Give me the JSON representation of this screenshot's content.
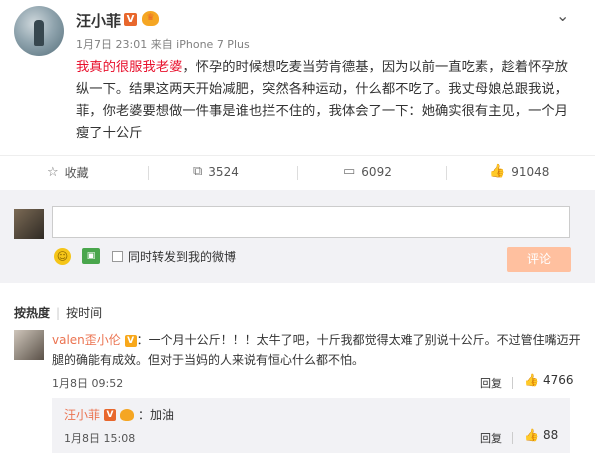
{
  "post": {
    "author": "汪小菲",
    "verified_badge": "V",
    "meta": "1月7日 23:01 来自 iPhone 7 Plus",
    "content_highlight": "我真的很服我老婆",
    "content_rest": "，怀孕的时候想吃麦当劳肯德基，因为以前一直吃素，趁着怀孕放纵一下。结果这两天开始减肥，突然各种运动，什么都不吃了。我丈母娘总跟我说，菲，你老婆要想做一件事是谁也拦不住的，我体会了一下：她确实很有主见，一个月瘦了十公斤"
  },
  "actions": {
    "collect": "收藏",
    "repost": "3524",
    "comment": "6092",
    "like": "91048"
  },
  "comment_box": {
    "placeholder": "",
    "repost_label": "同时转发到我的微博",
    "submit_label": "评论"
  },
  "sort": {
    "hot": "按热度",
    "time": "按时间"
  },
  "comments": [
    {
      "user": "valen歪小伦",
      "badge": "V",
      "text": "：一个月十公斤！！！太牛了吧，十斤我都觉得太难了别说十公斤。不过管住嘴迈开腿的确能有成效。但对于当妈的人来说有恒心什么都不怕。",
      "date": "1月8日 09:52",
      "reply": "回复",
      "likes": "4766"
    }
  ],
  "sub_reply": {
    "user": "汪小菲",
    "badge": "V",
    "text": "：加油",
    "date": "1月8日 15:08",
    "reply": "回复",
    "likes": "88"
  },
  "colors": {
    "highlight": "#e8112d",
    "username": "#eb7350",
    "submit_bg": "#ffc09f"
  }
}
